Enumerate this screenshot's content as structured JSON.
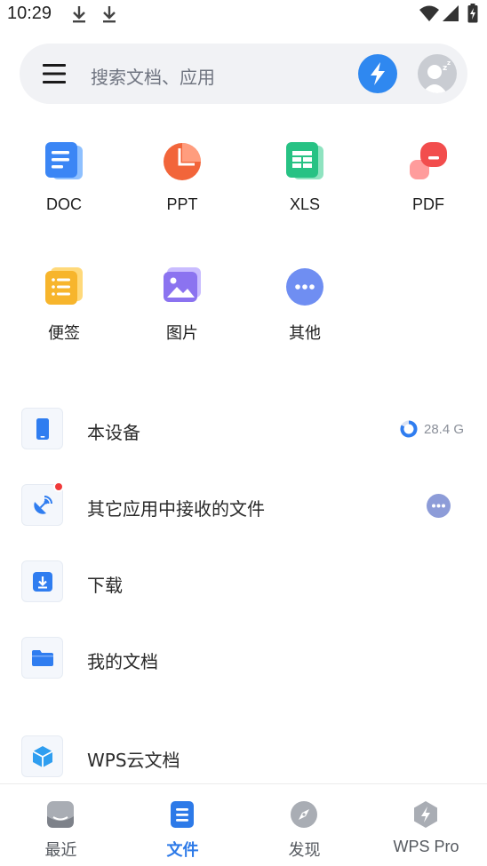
{
  "status_bar": {
    "time": "10:29"
  },
  "search": {
    "placeholder": "搜索文档、应用"
  },
  "categories": [
    {
      "label": "DOC",
      "icon": "doc-icon",
      "color": "#3b86f5"
    },
    {
      "label": "PPT",
      "icon": "ppt-icon",
      "color": "#f2653a"
    },
    {
      "label": "XLS",
      "icon": "xls-icon",
      "color": "#27c284"
    },
    {
      "label": "PDF",
      "icon": "pdf-icon",
      "color": "#f24d4d"
    },
    {
      "label": "便签",
      "icon": "memo-icon",
      "color": "#f7b52c"
    },
    {
      "label": "图片",
      "icon": "image-icon",
      "color": "#8b73f0"
    },
    {
      "label": "其他",
      "icon": "more-icon",
      "color": "#6f8ef2"
    }
  ],
  "locations": [
    {
      "label": "本设备",
      "icon": "phone-icon",
      "storage": "28.4 G"
    },
    {
      "label": "其它应用中接收的文件",
      "icon": "satellite-icon"
    },
    {
      "label": "下载",
      "icon": "download-icon"
    },
    {
      "label": "我的文档",
      "icon": "folder-icon"
    },
    {
      "label": "WPS云文档",
      "icon": "cloud-box-icon"
    }
  ],
  "bottom_nav": [
    {
      "label": "最近",
      "icon": "recent-icon"
    },
    {
      "label": "文件",
      "icon": "files-icon",
      "active": true
    },
    {
      "label": "发现",
      "icon": "compass-icon"
    },
    {
      "label": "WPS Pro",
      "icon": "pro-icon"
    }
  ],
  "colors": {
    "accent": "#2d7ae8",
    "search_bg": "#f1f2f5"
  }
}
